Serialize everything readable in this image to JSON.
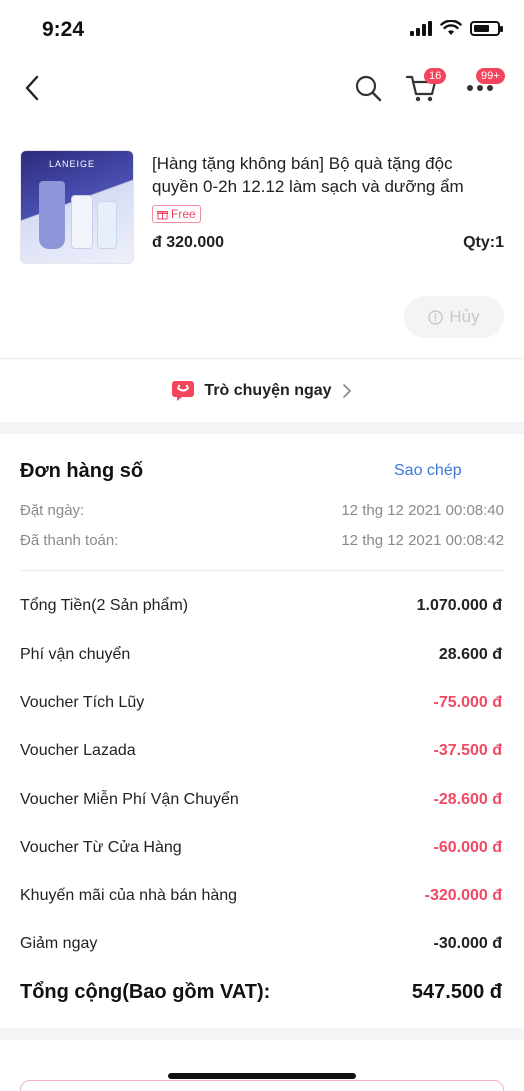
{
  "status_bar": {
    "time": "9:24"
  },
  "nav": {
    "cart_badge": "16",
    "more_badge": "99+"
  },
  "product": {
    "name": "[Hàng tặng không bán] Bộ quà tặng độc quyền 0-2h 12.12 làm sạch và dưỡng ẩm",
    "free_label": "Free",
    "price": "đ 320.000",
    "qty": "Qty:1",
    "cancel_label": "Hủy",
    "image_brand": "LANEIGE"
  },
  "chat": {
    "label": "Trò chuyện ngay"
  },
  "order": {
    "title": "Đơn hàng số",
    "copy_label": "Sao chép",
    "meta": [
      {
        "label": "Đặt ngày:",
        "value": "12 thg 12 2021  00:08:40"
      },
      {
        "label": "Đã thanh toán:",
        "value": "12 thg 12 2021  00:08:42"
      }
    ],
    "summary": [
      {
        "label": "Tổng Tiền(2 Sản phẩm)",
        "value": "1.070.000 đ",
        "negative": false
      },
      {
        "label": "Phí vận chuyển",
        "value": "28.600 đ",
        "negative": false
      },
      {
        "label": "Voucher Tích Lũy",
        "value": "-75.000 đ",
        "negative": true
      },
      {
        "label": "Voucher Lazada",
        "value": "-37.500 đ",
        "negative": true
      },
      {
        "label": "Voucher Miễn Phí Vận Chuyển",
        "value": "-28.600 đ",
        "negative": true
      },
      {
        "label": "Voucher Từ Cửa Hàng",
        "value": "-60.000 đ",
        "negative": true
      },
      {
        "label": "Khuyến mãi của nhà bán hàng",
        "value": "-320.000 đ",
        "negative": true
      },
      {
        "label": "Giảm ngay",
        "value": "-30.000 đ",
        "negative": false
      }
    ],
    "total_label": "Tổng cộng(Bao gồm VAT):",
    "total_value": "547.500 đ"
  },
  "colors": {
    "accent_red": "#f04a64",
    "link_blue": "#3c78d8",
    "badge_red": "#f5455c"
  }
}
